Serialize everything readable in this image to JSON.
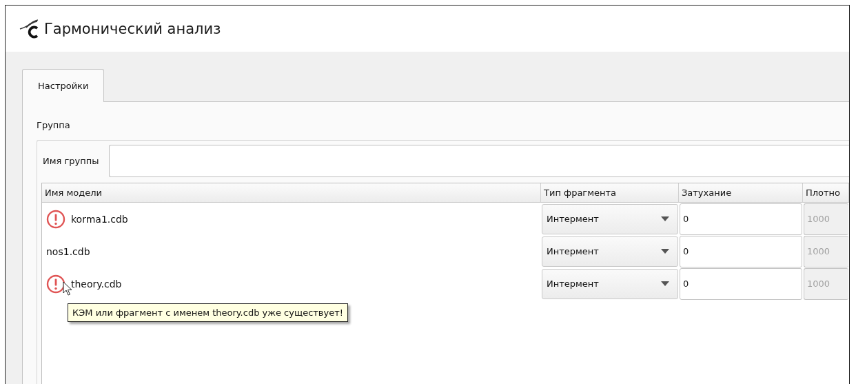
{
  "window": {
    "title": "Гармонический анализ"
  },
  "tabs": [
    {
      "label": "Настройки",
      "selected": true
    }
  ],
  "group": {
    "title": "Группа",
    "name_label": "Имя группы"
  },
  "table": {
    "columns": [
      "Имя модели",
      "Тип фрагмента",
      "Затухание",
      "Плотно"
    ],
    "rows": [
      {
        "name": "korma1.cdb",
        "error": true,
        "type": "Интермент",
        "damping": "0",
        "density": "1000",
        "density_disabled": true
      },
      {
        "name": "nos1.cdb",
        "error": false,
        "type": "Интермент",
        "damping": "0",
        "density": "1000",
        "density_disabled": true
      },
      {
        "name": "theory.cdb",
        "error": true,
        "type": "Интермент",
        "damping": "0",
        "density": "1000",
        "density_disabled": true,
        "tooltip": "КЭМ или фрагмент с именем theory.cdb уже существует!"
      }
    ]
  }
}
